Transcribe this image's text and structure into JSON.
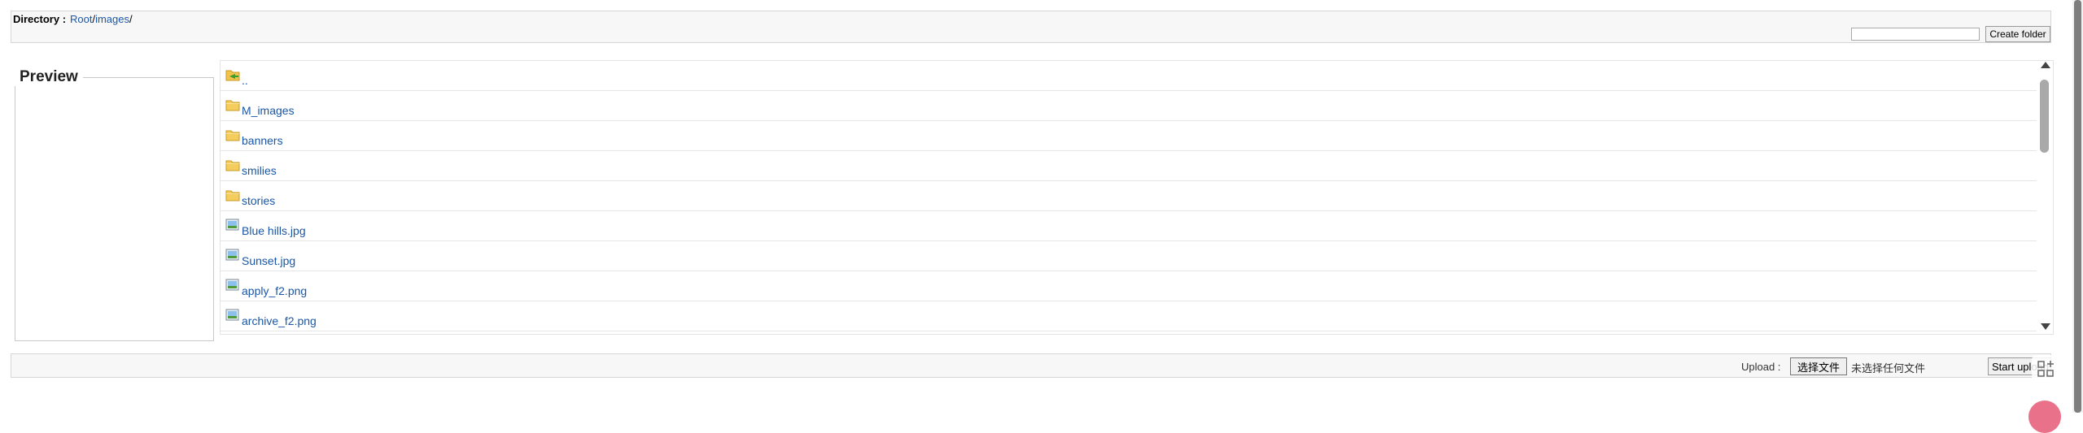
{
  "directory": {
    "label": "Directory :",
    "crumbs": [
      {
        "text": "Root"
      },
      {
        "text": "/"
      },
      {
        "text": "images"
      },
      {
        "text": "/"
      }
    ],
    "folder_input_value": "",
    "create_folder_label": "Create folder"
  },
  "preview": {
    "legend": "Preview"
  },
  "files": [
    {
      "name": "..",
      "icon": "folder-up-icon"
    },
    {
      "name": "M_images",
      "icon": "folder-icon"
    },
    {
      "name": "banners",
      "icon": "folder-icon"
    },
    {
      "name": "smilies",
      "icon": "folder-icon"
    },
    {
      "name": "stories",
      "icon": "folder-icon"
    },
    {
      "name": "Blue hills.jpg",
      "icon": "image-file-icon"
    },
    {
      "name": "Sunset.jpg",
      "icon": "image-file-icon"
    },
    {
      "name": "apply_f2.png",
      "icon": "image-file-icon"
    },
    {
      "name": "archive_f2.png",
      "icon": "image-file-icon"
    }
  ],
  "upload": {
    "label": "Upload :",
    "choose_file_label": "选择文件",
    "no_file_text": "未选择任何文件",
    "start_upload_label": "Start upload"
  },
  "colors": {
    "link": "#1a57a6",
    "folder": "#f2c24b",
    "bar_bg": "#f7f7f7"
  }
}
